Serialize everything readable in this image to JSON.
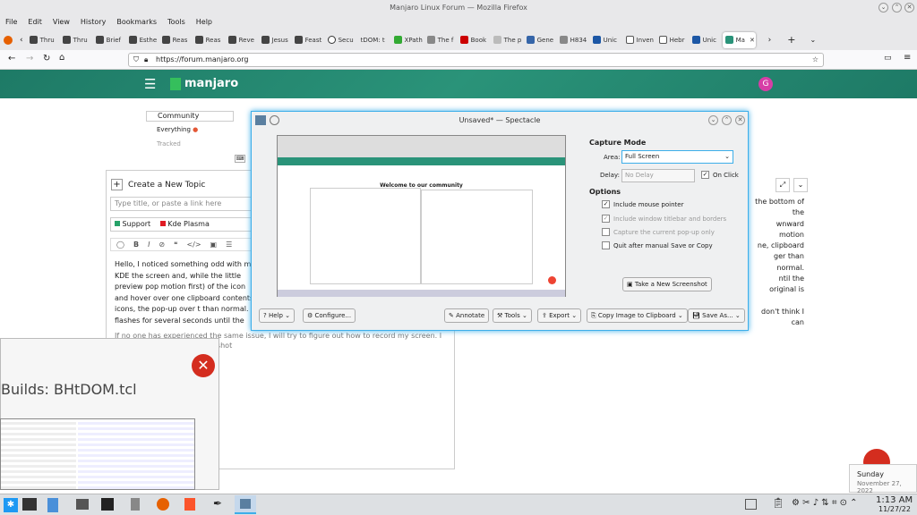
{
  "firefox": {
    "window_title": "Manjaro Linux Forum — Mozilla Firefox",
    "menu": [
      "File",
      "Edit",
      "View",
      "History",
      "Bookmarks",
      "Tools",
      "Help"
    ],
    "tabs": [
      "Thru",
      "Thru",
      "Brief",
      "Esthe",
      "Reas",
      "Reas",
      "Reve",
      "Jesus",
      "Feast",
      "Secu",
      "tDOM: t",
      "XPath",
      "The f",
      "Book",
      "The p",
      "Gene",
      "H834",
      "Unic",
      "Inven",
      "Hebr",
      "Unic",
      "Ma"
    ],
    "url": "https://forum.manjaro.org"
  },
  "forum": {
    "logo_text": "manjaro",
    "avatar_letter": "G",
    "sidebar": {
      "community": "Community",
      "everything": "Everything",
      "tracked": "Tracked"
    },
    "composer": {
      "create_label": "Create a New Topic",
      "title_placeholder": "Type title, or paste a link here",
      "category": "Support",
      "tag": "Kde Plasma",
      "body_left": "Hello, I noticed something odd with my KDE the screen and, while the little preview pop motion first) of the icon and hover over one clipboard contents icons, the pop-up over t than normal. It flashes for several seconds until the original is click again. It seems to",
      "body_right_lines": [
        "the bottom of the",
        "wnward motion",
        "ne, clipboard",
        "ger than normal.",
        "ntil the original is",
        "don't think I can"
      ],
      "body_bottom": "If no one has experienced the same issue, I will try to figure out how to record my screen. I don't think I can take a snapshot"
    }
  },
  "spectacle": {
    "title": "Unsaved* — Spectacle",
    "capture_mode": "Capture Mode",
    "area_label": "Area:",
    "area_value": "Full Screen",
    "delay_label": "Delay:",
    "delay_value": "No Delay",
    "on_click": "On Click",
    "options_label": "Options",
    "options": [
      {
        "label": "Include mouse pointer",
        "checked": true
      },
      {
        "label": "Include window titlebar and borders",
        "checked": true
      },
      {
        "label": "Capture the current pop-up only",
        "checked": false
      },
      {
        "label": "Quit after manual Save or Copy",
        "checked": false
      }
    ],
    "new_screenshot": "Take a New Screenshot",
    "buttons": {
      "help": "Help",
      "configure": "Configure...",
      "annotate": "Annotate",
      "tools": "Tools",
      "export": "Export",
      "copy": "Copy Image to Clipboard",
      "save": "Save As..."
    },
    "preview_heading": "Welcome to our community"
  },
  "popup": {
    "title": "Builds: BHtDOM.tcl"
  },
  "taskbar": {
    "time": "1:13 AM",
    "date": "11/27/22"
  },
  "notification": {
    "day": "Sunday",
    "date": "November 27, 2022"
  },
  "colors": {
    "manjaro_green": "#2a9379",
    "kde_blue": "#3daee9",
    "support": "#26a269",
    "kde_plasma": "#e01b24"
  }
}
